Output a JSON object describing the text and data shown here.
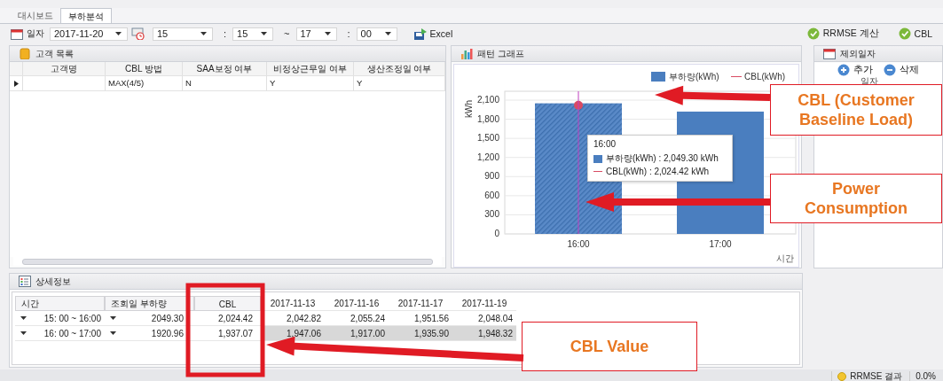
{
  "tabs": [
    {
      "label": "대시보드",
      "selected": false
    },
    {
      "label": "부하분석",
      "selected": true
    }
  ],
  "toolbar": {
    "date_label": "일자",
    "date": "2017-11-20",
    "start_hour": "15",
    "start_sep": ":",
    "start_minute": "15",
    "range_sep": "~",
    "end_hour": "17",
    "end_sep": ":",
    "end_minute": "00",
    "excel_button": "Excel",
    "right_buttons": [
      "RRMSE 계산",
      "CBL"
    ]
  },
  "customers": {
    "title": "고객 목록",
    "columns": [
      "고객명",
      "CBL 방법",
      "SAA보정 여부",
      "비정상근무일 여부",
      "생산조정일 여부"
    ],
    "rows": [
      {
        "current": true,
        "cells": [
          null,
          "MAX(4/5)",
          "N",
          "Y",
          "Y"
        ]
      }
    ]
  },
  "pattern": {
    "title": "패턴 그래프",
    "chart_data": {
      "type": "bar",
      "xlabel": "시간",
      "ylabel": "kWh",
      "categories": [
        "16:00",
        "17:00"
      ],
      "series": [
        {
          "name": "부하량(kWh)",
          "color": "#4a7ebf",
          "values": [
            2050,
            1920
          ]
        },
        {
          "name": "CBL(kWh)",
          "type": "line",
          "marker": "o",
          "color": "#d94b63",
          "values": [
            2020,
            null
          ]
        }
      ],
      "grid": true,
      "legend": "top right",
      "ref_lines": [
        {
          "axis": "x",
          "value": "16:00",
          "color": "#c040c0"
        }
      ],
      "ylim": [
        0,
        2100
      ],
      "yticks": [
        0,
        300,
        600,
        900,
        {
          "value": 1200,
          "label": "1,200"
        },
        {
          "value": 1500,
          "label": "1,500"
        },
        {
          "value": 1800,
          "label": "1,800"
        },
        {
          "value": 2100,
          "label": "2,100"
        }
      ]
    },
    "tooltip": {
      "title": "16:00",
      "lines": [
        {
          "kind": "bar",
          "text": "부하량(kWh) : 2,049.30 kWh"
        },
        {
          "kind": "line",
          "text": "CBL(kWh) : 2,024.42 kWh"
        }
      ]
    }
  },
  "excluded_dates": {
    "title": "제외일자",
    "buttons": [
      {
        "kind": "add",
        "label": "추가"
      },
      {
        "kind": "remove",
        "label": "삭제"
      }
    ],
    "columns": [
      "일자"
    ]
  },
  "detail": {
    "title": "상세정보",
    "columns": [
      "시간",
      "조회일 부하량",
      "CBL",
      "2017-11-13",
      "2017-11-16",
      "2017-11-17",
      "2017-11-19"
    ],
    "rows": [
      {
        "selected": false,
        "cells": [
          "15: 00 ~ 16:00",
          "2049.30",
          "2,024.42",
          "2,042.82",
          "2,055.24",
          "1,951.56",
          "2,048.04"
        ]
      },
      {
        "selected": true,
        "cells": [
          "16: 00 ~ 17:00",
          "1920.96",
          "1,937.07",
          "1,947.06",
          "1,917.00",
          "1,935.90",
          "1,948.32"
        ]
      }
    ]
  },
  "status_bar": {
    "items": [
      "RRMSE 결과",
      "0.0%"
    ]
  },
  "annotations": [
    {
      "text": "CBL (Customer Baseline Load)"
    },
    {
      "text": "Power Consumption"
    },
    {
      "text": "CBL Value"
    }
  ]
}
